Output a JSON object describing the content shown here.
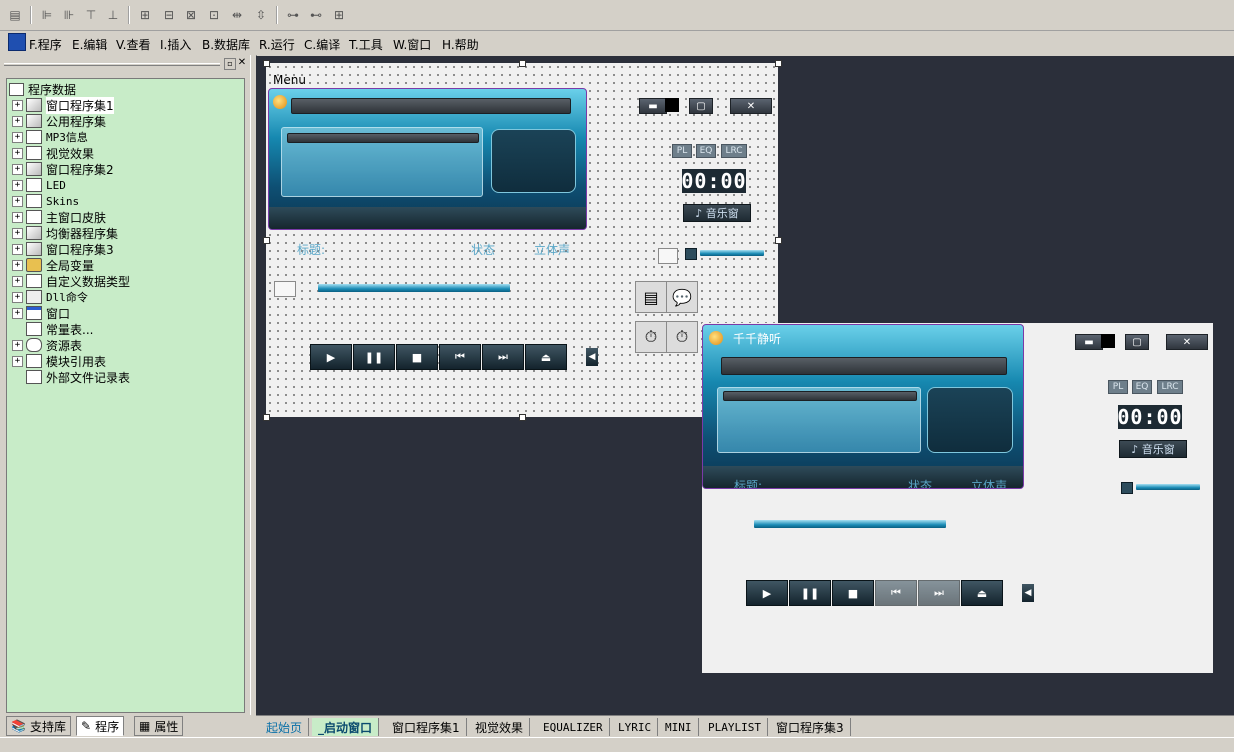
{
  "menubar": {
    "items": [
      "F.程序",
      "E.编辑",
      "V.查看",
      "I.插入",
      "B.数据库",
      "R.运行",
      "C.编译",
      "T.工具",
      "W.窗口",
      "H.帮助"
    ]
  },
  "left_panel": {
    "tree": [
      {
        "label": "程序数据",
        "expander": false
      },
      {
        "label": "窗口程序集1",
        "expander": true
      },
      {
        "label": "公用程序集",
        "expander": true
      },
      {
        "label": "MP3信息",
        "expander": true
      },
      {
        "label": "视觉效果",
        "expander": true
      },
      {
        "label": "窗口程序集2",
        "expander": true
      },
      {
        "label": "LED",
        "expander": true
      },
      {
        "label": "Skins",
        "expander": true
      },
      {
        "label": "主窗口皮肤",
        "expander": true
      },
      {
        "label": "均衡器程序集",
        "expander": true
      },
      {
        "label": "窗口程序集3",
        "expander": true
      },
      {
        "label": "全局变量",
        "expander": true
      },
      {
        "label": "自定义数据类型",
        "expander": true
      },
      {
        "label": "Dll命令",
        "expander": true
      },
      {
        "label": "窗口",
        "expander": true
      },
      {
        "label": "常量表...",
        "expander": false
      },
      {
        "label": "资源表",
        "expander": true
      },
      {
        "label": "模块引用表",
        "expander": true
      },
      {
        "label": "外部文件记录表",
        "expander": false
      }
    ],
    "tabs": [
      "支持库",
      "程序",
      "属性"
    ]
  },
  "designer": {
    "menu_label": "Menu",
    "skin_buttons": [
      "PL",
      "EQ",
      "LRC"
    ],
    "time": "00:00",
    "music_button": "♪ 音乐窗",
    "title_label": "标题:",
    "status_label": "状态",
    "stereo_label": "立体声",
    "close_glyph": "✕",
    "min_glyph": "▬",
    "max_glyph": "▢",
    "controls": [
      "▶",
      "❚❚",
      "■",
      "⏮",
      "⏭",
      "⏏"
    ],
    "volume_glyph": "◀"
  },
  "preview": {
    "title": "千千静听",
    "skin_buttons": [
      "PL",
      "EQ",
      "LRC"
    ],
    "time": "00:00",
    "music_button": "♪ 音乐窗",
    "title_label": "标题:",
    "status_label": "状态",
    "stereo_label": "立体声",
    "close_glyph": "✕",
    "min_glyph": "▬",
    "max_glyph": "▢",
    "controls": [
      "▶",
      "❚❚",
      "■",
      "⏮",
      "⏭",
      "⏏"
    ],
    "volume_glyph": "◀"
  },
  "bottom_tabs": [
    "起始页",
    "_启动窗口",
    "窗口程序集1",
    "视觉效果",
    "EQUALIZER",
    "LYRIC",
    "MINI",
    "PLAYLIST",
    "窗口程序集3"
  ],
  "colors": {
    "tree_bg": "#c8ecc8",
    "workspace_bg": "#2b2f3a",
    "accent": "#1b8cb6"
  }
}
